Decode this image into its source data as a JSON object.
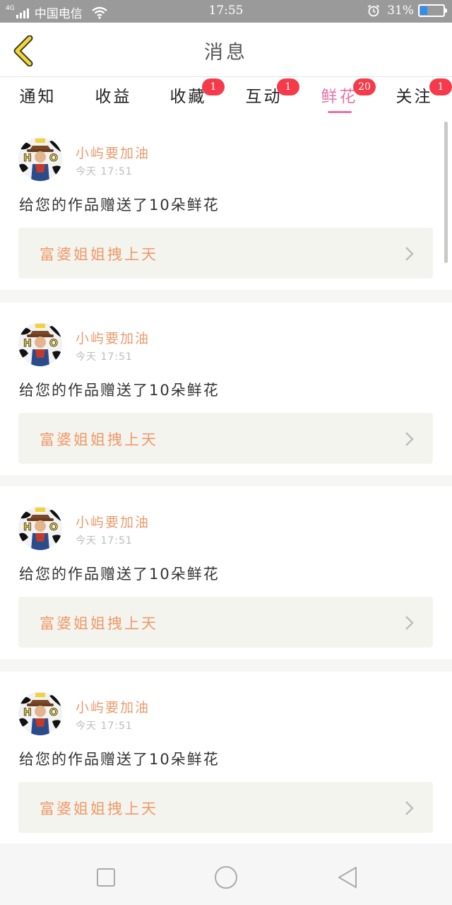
{
  "status_bar": {
    "network": "4G",
    "carrier": "中国电信",
    "time": "17:55",
    "battery_text": "31%",
    "battery_level": 0.31,
    "battery_color": "#2f8ef0"
  },
  "header": {
    "title": "消息",
    "back_icon": "chevron-left-icon"
  },
  "tabs": [
    {
      "label": "通知",
      "badge": null,
      "active": false
    },
    {
      "label": "收益",
      "badge": null,
      "active": false
    },
    {
      "label": "收藏",
      "badge": "1",
      "active": false
    },
    {
      "label": "互动",
      "badge": "1",
      "active": false
    },
    {
      "label": "鲜花",
      "badge": "20",
      "active": true
    },
    {
      "label": "关注",
      "badge": "1",
      "active": false
    }
  ],
  "colors": {
    "active_tab": "#e773a7",
    "badge": "#f53b4b",
    "username": "#e99c6e",
    "work_title": "#ef9a6b"
  },
  "feed": {
    "items": [
      {
        "username": "小屿要加油",
        "timestamp": "今天 17:51",
        "message": "给您的作品赠送了10朵鲜花",
        "work_title": "富婆姐姐拽上天"
      },
      {
        "username": "小屿要加油",
        "timestamp": "今天 17:51",
        "message": "给您的作品赠送了10朵鲜花",
        "work_title": "富婆姐姐拽上天"
      },
      {
        "username": "小屿要加油",
        "timestamp": "今天 17:51",
        "message": "给您的作品赠送了10朵鲜花",
        "work_title": "富婆姐姐拽上天"
      },
      {
        "username": "小屿要加油",
        "timestamp": "今天 17:51",
        "message": "给您的作品赠送了10朵鲜花",
        "work_title": "富婆姐姐拽上天"
      }
    ]
  },
  "nav_bar": {
    "icons": [
      "square-recents-icon",
      "circle-home-icon",
      "triangle-back-icon"
    ]
  }
}
